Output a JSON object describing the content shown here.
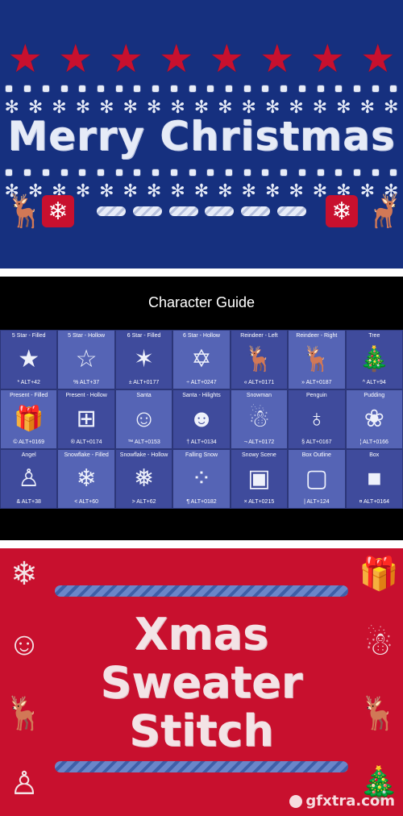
{
  "banner_top": {
    "title": "Merry Christmas",
    "stars": [
      "★",
      "★",
      "★",
      "★",
      "★",
      "★",
      "★",
      "★"
    ],
    "flakes": [
      "✻",
      "✻",
      "✻",
      "✻",
      "✻",
      "✻",
      "✻",
      "✻",
      "✻",
      "✻",
      "✻",
      "✻",
      "✻",
      "✻",
      "✻",
      "✻",
      "✻"
    ],
    "left_deer": "🦌",
    "right_deer": "🦌",
    "badge_glyph": "❄",
    "colors": {
      "background": "#16307f",
      "accent": "#c8102e",
      "knit": "#e7ecf8"
    }
  },
  "guide": {
    "title": "Character Guide",
    "cells": [
      {
        "name": "5 Star - Filled",
        "glyph": "★",
        "code": "* ALT+42"
      },
      {
        "name": "5 Star - Hollow",
        "glyph": "☆",
        "code": "% ALT+37"
      },
      {
        "name": "6 Star - Filled",
        "glyph": "✶",
        "code": "± ALT+0177"
      },
      {
        "name": "6 Star - Hollow",
        "glyph": "✡",
        "code": "÷ ALT+0247"
      },
      {
        "name": "Reindeer - Left",
        "glyph": "🦌",
        "code": "« ALT+0171"
      },
      {
        "name": "Reindeer - Right",
        "glyph": "🦌",
        "code": "» ALT+0187"
      },
      {
        "name": "Tree",
        "glyph": "🎄",
        "code": "^ ALT+94"
      },
      {
        "name": "Present - Filled",
        "glyph": "🎁",
        "code": "© ALT+0169"
      },
      {
        "name": "Present - Hollow",
        "glyph": "⊞",
        "code": "® ALT+0174"
      },
      {
        "name": "Santa",
        "glyph": "☺",
        "code": "™ ALT+0153"
      },
      {
        "name": "Santa - Hilights",
        "glyph": "☻",
        "code": "† ALT+0134"
      },
      {
        "name": "Snowman",
        "glyph": "☃",
        "code": "¬ ALT+0172"
      },
      {
        "name": "Penguin",
        "glyph": "♁",
        "code": "§ ALT+0167"
      },
      {
        "name": "Pudding",
        "glyph": "❀",
        "code": "¦ ALT+0166"
      },
      {
        "name": "Angel",
        "glyph": "♙",
        "code": "& ALT+38"
      },
      {
        "name": "Snowflake - Filled",
        "glyph": "❄",
        "code": "< ALT+60"
      },
      {
        "name": "Snowflake - Hollow",
        "glyph": "❅",
        "code": "> ALT+62"
      },
      {
        "name": "Falling Snow",
        "glyph": "⁘",
        "code": "¶ ALT+0182"
      },
      {
        "name": "Snowy Scene",
        "glyph": "▣",
        "code": "× ALT+0215"
      },
      {
        "name": "Box Outline",
        "glyph": "▢",
        "code": "| ALT+124"
      },
      {
        "name": "Box",
        "glyph": "■",
        "code": "¤ ALT+0164"
      }
    ]
  },
  "banner_bottom": {
    "line1": "Xmas",
    "line2": "Sweater",
    "line3": "Stitch",
    "left_icons": [
      "❄",
      "☺",
      "🦌",
      "♙"
    ],
    "right_icons": [
      "🎁",
      "☃",
      "🦌",
      "🎄"
    ],
    "colors": {
      "background": "#c8102e",
      "knit": "#f3e3e6",
      "wave": "#6a86c9"
    }
  },
  "watermark": "gfxtra.com"
}
